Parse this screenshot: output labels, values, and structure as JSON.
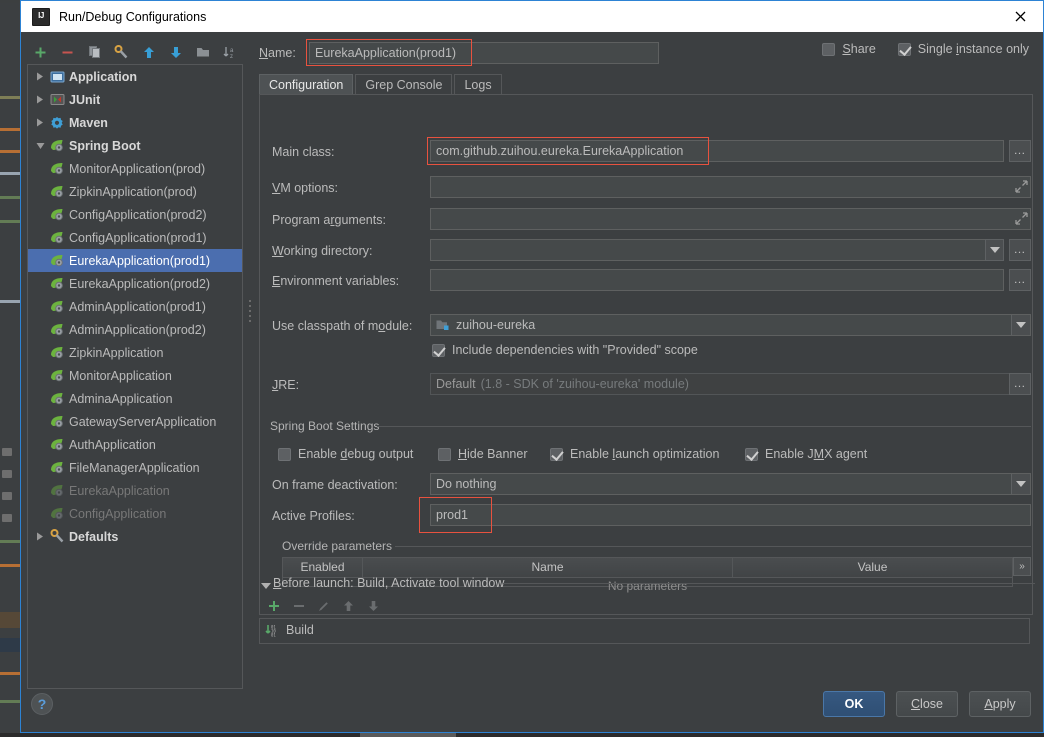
{
  "window": {
    "title": "Run/Debug Configurations",
    "app_icon": "intellij-idea-icon",
    "close_icon": "close-icon"
  },
  "tree_toolbar": [
    {
      "name": "add-configuration-button",
      "icon": "plus-icon",
      "color": "#59a869"
    },
    {
      "name": "remove-configuration-button",
      "icon": "minus-icon",
      "color": "#c75450"
    },
    {
      "name": "copy-configuration-button",
      "icon": "copy-icon",
      "color": "#9aa0a6"
    },
    {
      "name": "edit-templates-button",
      "icon": "wrench-icon",
      "color": "#d9a343"
    },
    {
      "name": "move-up-button",
      "icon": "arrow-up-icon",
      "color": "#389fd6"
    },
    {
      "name": "move-down-button",
      "icon": "arrow-down-icon",
      "color": "#389fd6"
    },
    {
      "name": "move-into-folder-button",
      "icon": "folder-icon",
      "color": "#9aa0a6"
    },
    {
      "name": "sort-configurations-button",
      "icon": "sort-alpha-icon",
      "color": "#9aa0a6"
    }
  ],
  "tree": {
    "items": [
      {
        "label": "Application",
        "level": 0,
        "group": true,
        "expanded": false,
        "icon": "application-icon"
      },
      {
        "label": "JUnit",
        "level": 0,
        "group": true,
        "expanded": false,
        "icon": "junit-icon"
      },
      {
        "label": "Maven",
        "level": 0,
        "group": true,
        "expanded": false,
        "icon": "maven-icon"
      },
      {
        "label": "Spring Boot",
        "level": 0,
        "group": true,
        "expanded": true,
        "icon": "spring-boot-icon"
      },
      {
        "label": "MonitorApplication(prod)",
        "level": 1,
        "icon": "spring-boot-icon"
      },
      {
        "label": "ZipkinApplication(prod)",
        "level": 1,
        "icon": "spring-boot-icon"
      },
      {
        "label": "ConfigApplication(prod2)",
        "level": 1,
        "icon": "spring-boot-icon"
      },
      {
        "label": "ConfigApplication(prod1)",
        "level": 1,
        "icon": "spring-boot-icon"
      },
      {
        "label": "EurekaApplication(prod1)",
        "level": 1,
        "icon": "spring-boot-icon",
        "selected": true
      },
      {
        "label": "EurekaApplication(prod2)",
        "level": 1,
        "icon": "spring-boot-icon"
      },
      {
        "label": "AdminApplication(prod1)",
        "level": 1,
        "icon": "spring-boot-icon"
      },
      {
        "label": "AdminApplication(prod2)",
        "level": 1,
        "icon": "spring-boot-icon"
      },
      {
        "label": "ZipkinApplication",
        "level": 1,
        "icon": "spring-boot-icon"
      },
      {
        "label": "MonitorApplication",
        "level": 1,
        "icon": "spring-boot-icon"
      },
      {
        "label": "AdminaApplication",
        "level": 1,
        "icon": "spring-boot-icon"
      },
      {
        "label": "GatewayServerApplication",
        "level": 1,
        "icon": "spring-boot-icon"
      },
      {
        "label": "AuthApplication",
        "level": 1,
        "icon": "spring-boot-icon"
      },
      {
        "label": "FileManagerApplication",
        "level": 1,
        "icon": "spring-boot-icon"
      },
      {
        "label": "EurekaApplication",
        "level": 1,
        "icon": "spring-boot-icon",
        "dimmed": true
      },
      {
        "label": "ConfigApplication",
        "level": 1,
        "icon": "spring-boot-icon",
        "dimmed": true
      },
      {
        "label": "Defaults",
        "level": 0,
        "group": true,
        "expanded": false,
        "icon": "defaults-wrench-icon"
      }
    ]
  },
  "header": {
    "name_label": "Name:",
    "name_value": "EurekaApplication(prod1)",
    "share_label": "Share",
    "share_checked": false,
    "single_instance_label": "Single instance only",
    "single_instance_checked": true
  },
  "tabs": [
    {
      "label": "Configuration",
      "active": true
    },
    {
      "label": "Grep Console",
      "active": false
    },
    {
      "label": "Logs",
      "active": false
    }
  ],
  "configuration": {
    "main_class_label": "Main class:",
    "main_class_value": "com.github.zuihou.eureka.EurekaApplication",
    "vm_options_label": "VM options:",
    "vm_options_value": "",
    "program_arguments_label": "Program arguments:",
    "program_arguments_value": "",
    "working_directory_label": "Working directory:",
    "working_directory_value": "",
    "environment_variables_label": "Environment variables:",
    "environment_variables_value": "",
    "classpath_label": "Use classpath of module:",
    "classpath_value": "zuihou-eureka",
    "classpath_icon": "module-folder-icon",
    "include_provided_label": "Include dependencies with \"Provided\" scope",
    "include_provided_checked": true,
    "jre_label": "JRE:",
    "jre_value": "Default",
    "jre_hint": "(1.8 - SDK of 'zuihou-eureka' module)",
    "spring_boot_settings_label": "Spring Boot Settings",
    "enable_debug_label": "Enable debug output",
    "enable_debug_checked": false,
    "hide_banner_label": "Hide Banner",
    "hide_banner_checked": false,
    "enable_launch_opt_label": "Enable launch optimization",
    "enable_launch_opt_checked": true,
    "enable_jmx_label": "Enable JMX agent",
    "enable_jmx_checked": true,
    "frame_deactivation_label": "On frame deactivation:",
    "frame_deactivation_value": "Do nothing",
    "active_profiles_label": "Active Profiles:",
    "active_profiles_value": "prod1",
    "override_parameters_label": "Override parameters",
    "param_columns": [
      "Enabled",
      "Name",
      "Value"
    ],
    "param_empty_text": "No parameters",
    "param_overflow_icon": "chevron-double-right-icon",
    "browse_icon": "ellipsis-icon",
    "expand_icon": "expand-editor-icon",
    "dropdown_icon": "chevron-down-icon"
  },
  "before_launch": {
    "title": "Before launch: Build, Activate tool window",
    "collapse_icon": "triangle-down-icon",
    "toolbar": [
      {
        "name": "add-task-button",
        "icon": "plus-icon",
        "enabled": true
      },
      {
        "name": "remove-task-button",
        "icon": "minus-icon",
        "enabled": false
      },
      {
        "name": "edit-task-button",
        "icon": "pencil-icon",
        "enabled": false
      },
      {
        "name": "move-task-up-button",
        "icon": "arrow-up-icon",
        "enabled": false
      },
      {
        "name": "move-task-down-button",
        "icon": "arrow-down-icon",
        "enabled": false
      }
    ],
    "tasks": [
      {
        "label": "Build",
        "icon": "build-icon"
      }
    ]
  },
  "footer": {
    "help_label": "?",
    "ok_label": "OK",
    "close_label": "Close",
    "apply_label": "Apply"
  },
  "colors": {
    "accent_blue": "#2d83d4",
    "selection_blue": "#4b6eaf",
    "highlight_red": "#e8523f",
    "green": "#59a869",
    "panel_bg": "#3c3f41",
    "field_bg": "#45494a"
  }
}
